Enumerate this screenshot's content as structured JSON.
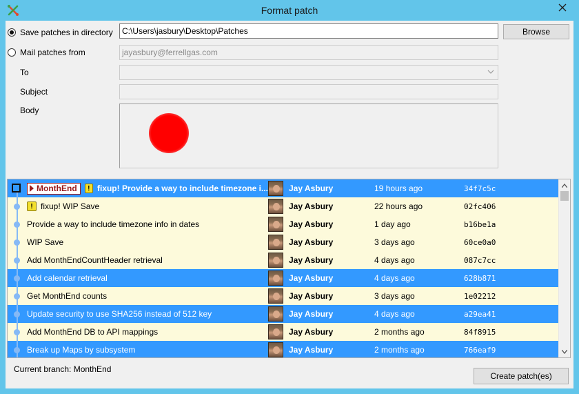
{
  "window": {
    "title": "Format patch",
    "close_icon": "close-icon",
    "app_icon": "git-extensions-icon"
  },
  "save_option": {
    "label": "Save patches in directory",
    "checked": true
  },
  "directory": {
    "value": "C:\\Users\\jasbury\\Desktop\\Patches"
  },
  "browse": {
    "label": "Browse"
  },
  "mail_option": {
    "label": "Mail patches from",
    "checked": false
  },
  "mail_from": {
    "value": "jayasbury@ferrellgas.com"
  },
  "to": {
    "label": "To",
    "value": ""
  },
  "subject": {
    "label": "Subject",
    "value": ""
  },
  "body": {
    "label": "Body",
    "value": ""
  },
  "commits": [
    {
      "branch": "MonthEnd",
      "warning": true,
      "message": "fixup! Provide a way to include timezone i...",
      "author": "Jay Asbury",
      "date": "19 hours ago",
      "hash": "34f7c5c",
      "selected": true,
      "head": true
    },
    {
      "branch": "",
      "warning": true,
      "message": "fixup! WIP Save",
      "author": "Jay Asbury",
      "date": "22 hours ago",
      "hash": "02fc406",
      "selected": false,
      "head": false
    },
    {
      "branch": "",
      "warning": false,
      "message": "Provide a way to include timezone info in dates",
      "author": "Jay Asbury",
      "date": "1 day ago",
      "hash": "b16be1a",
      "selected": false,
      "head": false
    },
    {
      "branch": "",
      "warning": false,
      "message": "WIP Save",
      "author": "Jay Asbury",
      "date": "3 days ago",
      "hash": "60ce0a0",
      "selected": false,
      "head": false
    },
    {
      "branch": "",
      "warning": false,
      "message": "Add MonthEndCountHeader retrieval",
      "author": "Jay Asbury",
      "date": "4 days ago",
      "hash": "087c7cc",
      "selected": false,
      "head": false
    },
    {
      "branch": "",
      "warning": false,
      "message": "Add calendar retrieval",
      "author": "Jay Asbury",
      "date": "4 days ago",
      "hash": "628b871",
      "selected": true,
      "head": false
    },
    {
      "branch": "",
      "warning": false,
      "message": "Get MonthEnd counts",
      "author": "Jay Asbury",
      "date": "3 days ago",
      "hash": "1e02212",
      "selected": false,
      "head": false
    },
    {
      "branch": "",
      "warning": false,
      "message": "Update security to use SHA256 instead of 512 key",
      "author": "Jay Asbury",
      "date": "4 days ago",
      "hash": "a29ea41",
      "selected": true,
      "head": false
    },
    {
      "branch": "",
      "warning": false,
      "message": "Add MonthEnd DB to API mappings",
      "author": "Jay Asbury",
      "date": "2 months ago",
      "hash": "84f8915",
      "selected": false,
      "head": false
    },
    {
      "branch": "",
      "warning": false,
      "message": "Break up Maps by subsystem",
      "author": "Jay Asbury",
      "date": "2 months ago",
      "hash": "766eaf9",
      "selected": true,
      "head": false
    }
  ],
  "status": {
    "current_branch": "Current branch: MonthEnd"
  },
  "create": {
    "label": "Create patch(es)"
  },
  "colors": {
    "selection": "#3399ff",
    "row_bg": "#fdfadb",
    "titlebar": "#62c5ea",
    "branch": "#9b1a1a"
  }
}
